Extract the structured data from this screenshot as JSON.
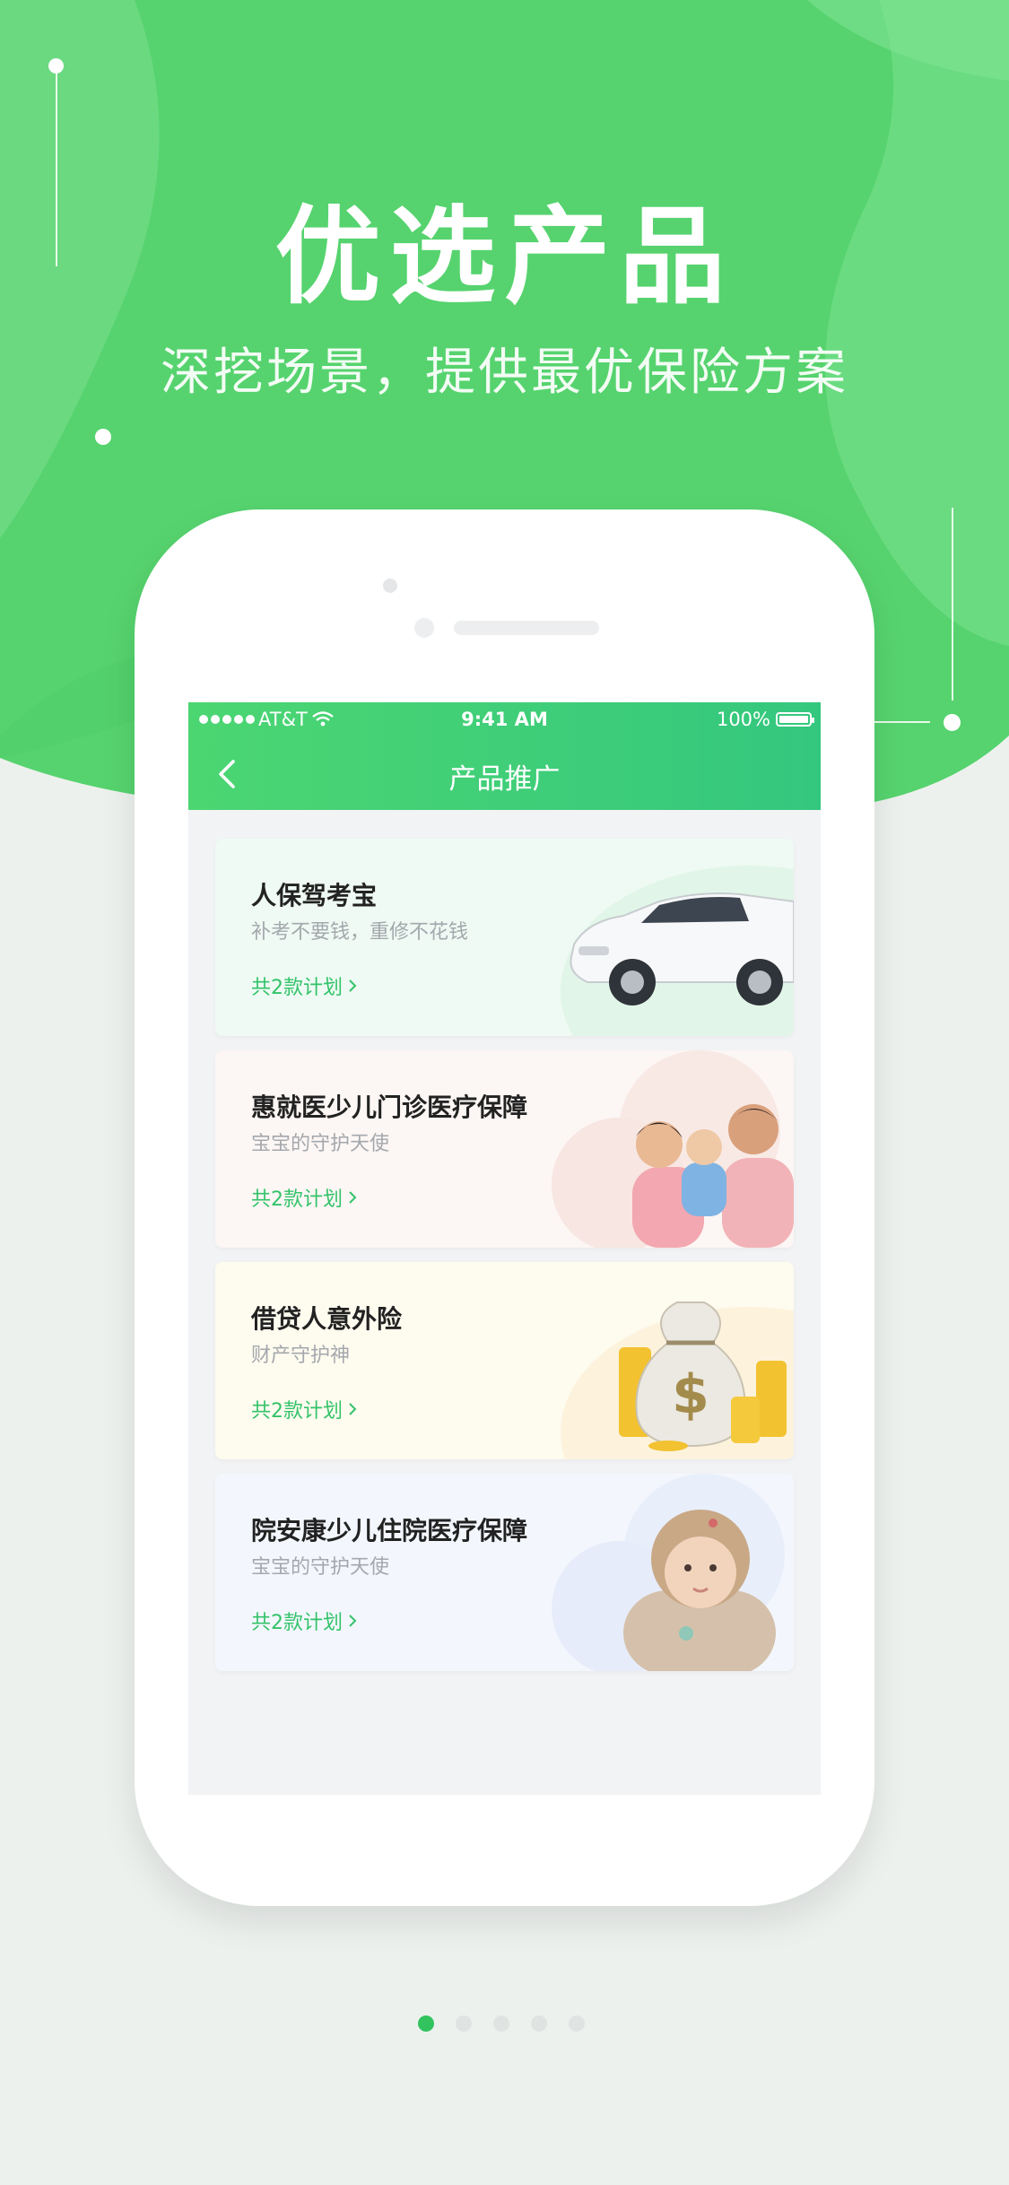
{
  "hero": {
    "title": "优选产品",
    "subtitle": "深挖场景，提供最优保险方案"
  },
  "status_bar": {
    "carrier": "AT&T",
    "time": "9:41 AM",
    "battery": "100%"
  },
  "nav": {
    "title": "产品推广",
    "back_icon": "chevron-left-icon"
  },
  "products": [
    {
      "title": "人保驾考宝",
      "desc": "补考不要钱，重修不花钱",
      "link": "共2款计划",
      "image": "car",
      "bg": "#eefaf3"
    },
    {
      "title": "惠就医少儿门诊医疗保障",
      "desc": "宝宝的守护天使",
      "link": "共2款计划",
      "image": "family",
      "bg": "#fcf6f4"
    },
    {
      "title": "借贷人意外险",
      "desc": "财产守护神",
      "link": "共2款计划",
      "image": "money-bag",
      "bg": "#fefbef"
    },
    {
      "title": "院安康少儿住院医疗保障",
      "desc": "宝宝的守护天使",
      "link": "共2款计划",
      "image": "baby",
      "bg": "#f3f7fd"
    }
  ],
  "pager": {
    "total": 5,
    "active": 0
  },
  "colors": {
    "brand_green": "#4cd672",
    "link_green": "#34c36a",
    "page_bg": "#edf1ee"
  }
}
